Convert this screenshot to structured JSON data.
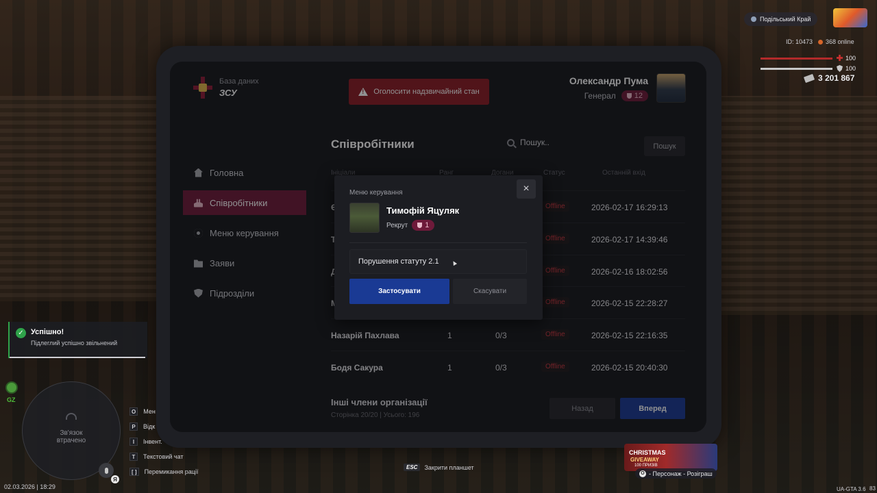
{
  "brand": {
    "subtitle": "База даних",
    "title": "ЗСУ"
  },
  "emergency_button": "Оголосити надзвичайний стан",
  "user": {
    "name": "Олександр Пума",
    "rank": "Генерал",
    "level": "12"
  },
  "nav": [
    {
      "label": "Головна",
      "icon": "home-icon",
      "active": false
    },
    {
      "label": "Співробітники",
      "icon": "users-icon",
      "active": true
    },
    {
      "label": "Меню керування",
      "icon": "gear-icon",
      "active": false
    },
    {
      "label": "Заяви",
      "icon": "folder-icon",
      "active": false
    },
    {
      "label": "Підрозділи",
      "icon": "shield-icon",
      "active": false
    }
  ],
  "employees": {
    "title": "Співробітники",
    "search_placeholder": "Пошук..",
    "search_button": "Пошук",
    "columns": [
      "Ініціали",
      "Ранг",
      "Догани",
      "Статус",
      "Останній вхід"
    ],
    "rows": [
      {
        "name": "Є",
        "level": "",
        "warns": "",
        "status": "Offline",
        "last": "2026-02-17 16:29:13"
      },
      {
        "name": "Т",
        "level": "",
        "warns": "",
        "status": "Offline",
        "last": "2026-02-17 14:39:46"
      },
      {
        "name": "Д",
        "level": "",
        "warns": "",
        "status": "Offline",
        "last": "2026-02-16 18:02:56"
      },
      {
        "name": "М",
        "level": "",
        "warns": "",
        "status": "Offline",
        "last": "2026-02-15 22:28:27"
      },
      {
        "name": "Назарій Пахлава",
        "level": "1",
        "warns": "0/3",
        "status": "Offline",
        "last": "2026-02-15 22:16:35"
      },
      {
        "name": "Бодя Сакура",
        "level": "1",
        "warns": "0/3",
        "status": "Offline",
        "last": "2026-02-15 20:40:30"
      }
    ],
    "footer_title": "Інші члени організації",
    "footer_sub": "Сторінка 20/20 | Усього: 196",
    "back_button": "Назад",
    "next_button": "Вперед"
  },
  "modal": {
    "label": "Меню керування",
    "close_icon": "×",
    "name": "Тимофій Яцуляк",
    "rank": "Рекрут",
    "level": "1",
    "reason_value": "Порушення статуту 2.1",
    "apply_button": "Застосувати",
    "cancel_button": "Скасувати"
  },
  "hud": {
    "server": "Подільський Край",
    "id": "ID: 10473",
    "online": "368 online",
    "health": "100",
    "armor": "100",
    "money": "3 201 867",
    "datetime": "02.03.2026 | 18:29",
    "gz": "GZ",
    "radar_text": "Зв'язок втрачено",
    "mic_key": "Я",
    "keys": [
      {
        "key": "O",
        "label": "Мен"
      },
      {
        "key": "P",
        "label": "Відк"
      },
      {
        "key": "I",
        "label": "Інвент."
      },
      {
        "key": "T",
        "label": "Текстовий чат"
      },
      {
        "key": "[ ]",
        "label": "Перемикання рації"
      }
    ],
    "esc_key": "ESC",
    "esc_label": "Закрити планшет",
    "promo_line1": "CHRISTMAS",
    "promo_line2": "GIVEAWAY",
    "promo_line3": "100 ПРИЗІВ",
    "promo_key": "O",
    "promo_label": "- Персонаж - Розіграш",
    "version": "UA-GTA 3.6",
    "fps": "83"
  },
  "toast": {
    "title": "Успішно!",
    "text": "Підлеглий успішно звільнений"
  },
  "colors": {
    "accent": "#6e1a3a",
    "primary": "#1a3a94",
    "danger": "#8b1d25",
    "success": "#2fa34a"
  }
}
